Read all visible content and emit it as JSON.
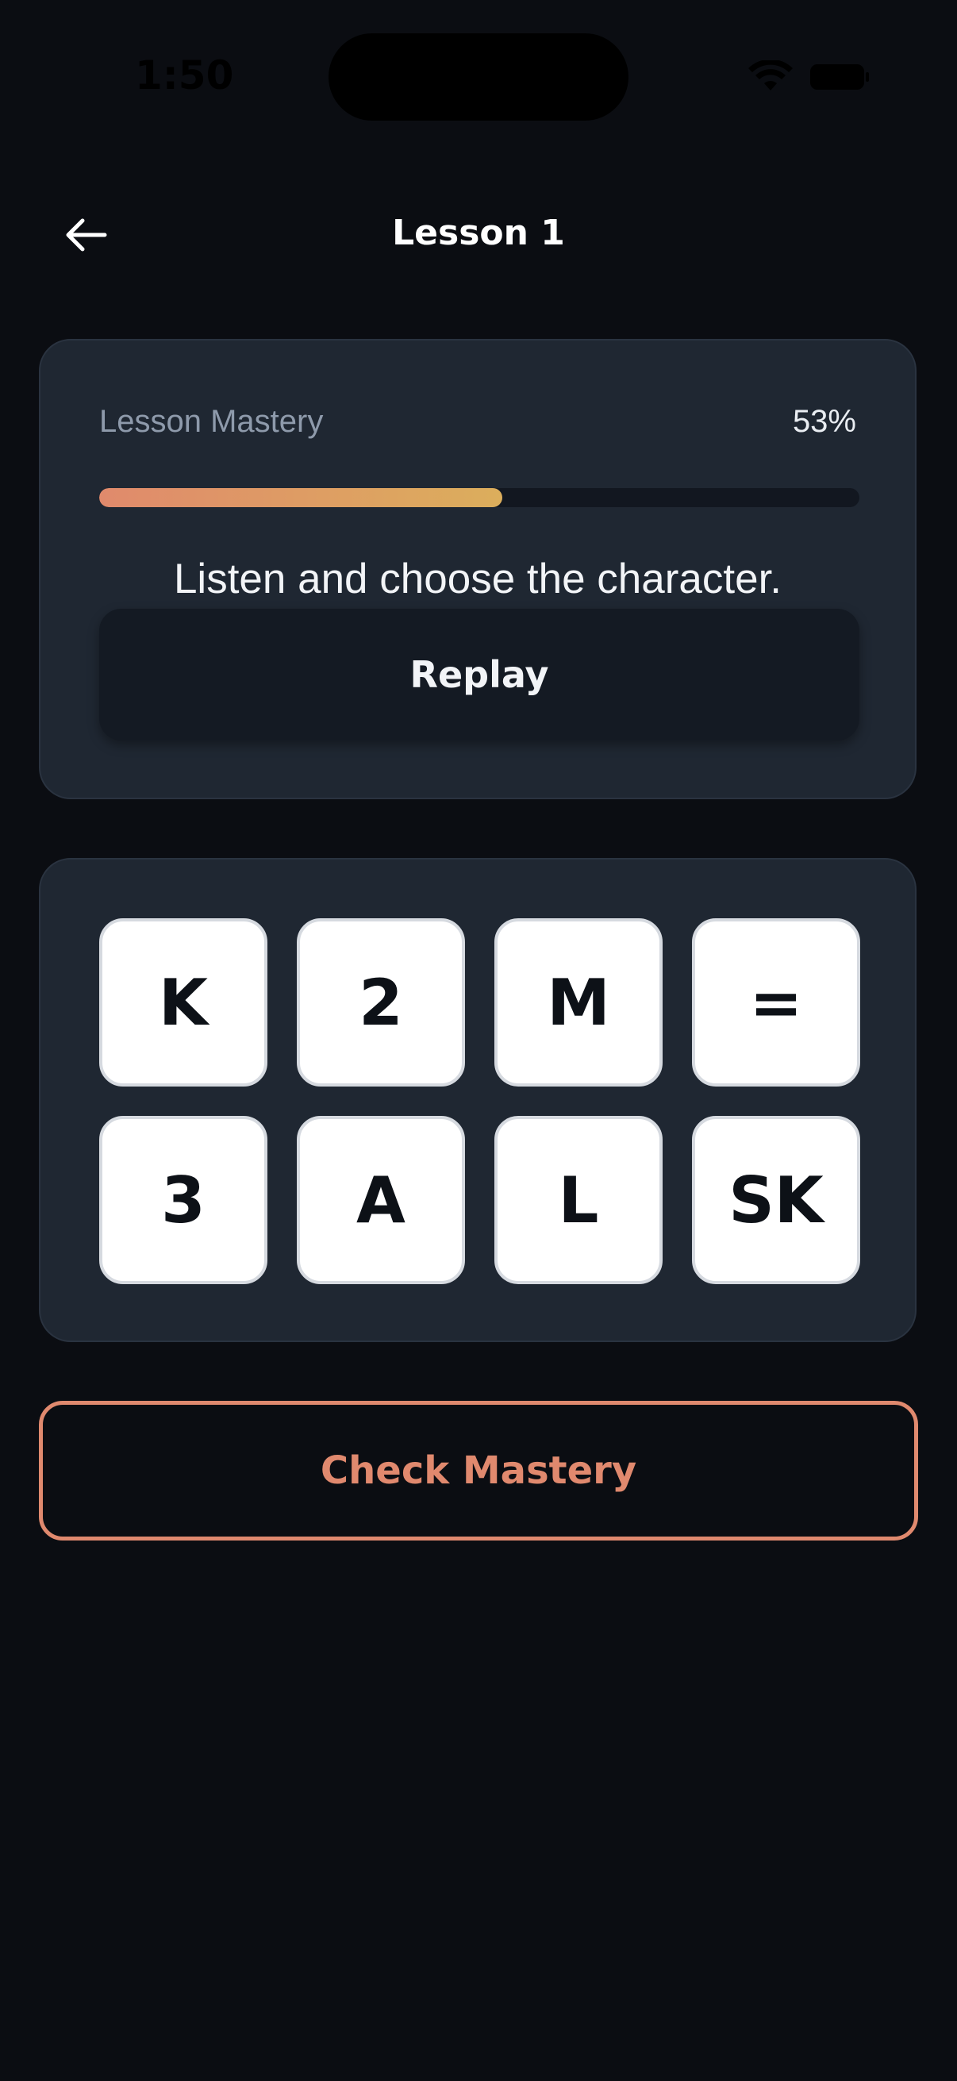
{
  "status_bar": {
    "time": "1:50",
    "wifi_icon": "wifi-icon",
    "battery_icon": "battery-icon"
  },
  "header": {
    "back_icon": "arrow-left-icon",
    "title": "Lesson 1"
  },
  "mastery": {
    "label": "Lesson Mastery",
    "percent_text": "53%",
    "progress_fraction": 0.53,
    "prompt": "Listen and choose the character.",
    "replay_label": "Replay"
  },
  "choices": [
    "K",
    "2",
    "M",
    "=",
    "3",
    "A",
    "L",
    "SK"
  ],
  "check_button_label": "Check Mastery",
  "colors": {
    "background": "#0b0d12",
    "card": "#1f2732",
    "accent": "#e0896e",
    "progress_start": "#e08a6c",
    "progress_end": "#dcae5c"
  }
}
